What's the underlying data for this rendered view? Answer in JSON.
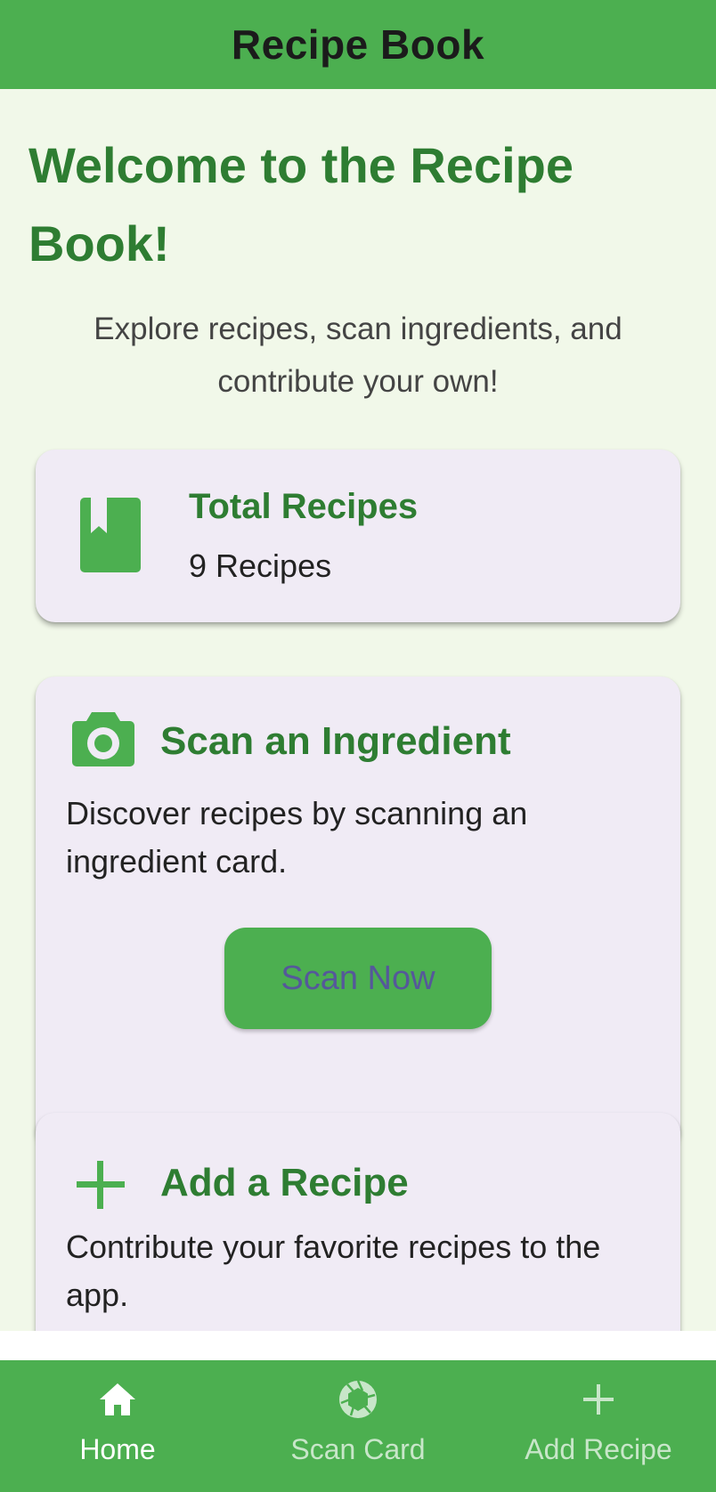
{
  "app_bar": {
    "title": "Recipe Book"
  },
  "welcome": {
    "title": "Welcome to the Recipe Book!",
    "subtitle": "Explore recipes, scan ingredients, and contribute your own!"
  },
  "total_card": {
    "icon": "book-icon",
    "title": "Total Recipes",
    "count_text": "9 Recipes"
  },
  "scan_card": {
    "icon": "camera-icon",
    "title": "Scan an Ingredient",
    "description": "Discover recipes by scanning an ingredient card.",
    "button_label": "Scan Now"
  },
  "add_card": {
    "icon": "plus-icon",
    "title": "Add a Recipe",
    "description": "Contribute your favorite recipes to the app."
  },
  "bottom_nav": {
    "items": [
      {
        "label": "Home",
        "icon": "home-icon",
        "active": true
      },
      {
        "label": "Scan Card",
        "icon": "camera-shutter-icon",
        "active": false
      },
      {
        "label": "Add Recipe",
        "icon": "plus-icon",
        "active": false
      }
    ]
  },
  "colors": {
    "primary": "#4caf50",
    "heading_green": "#2e7d32",
    "background": "#f1f8e9",
    "card_background": "#f0ebf5",
    "button_text": "#55589a"
  }
}
